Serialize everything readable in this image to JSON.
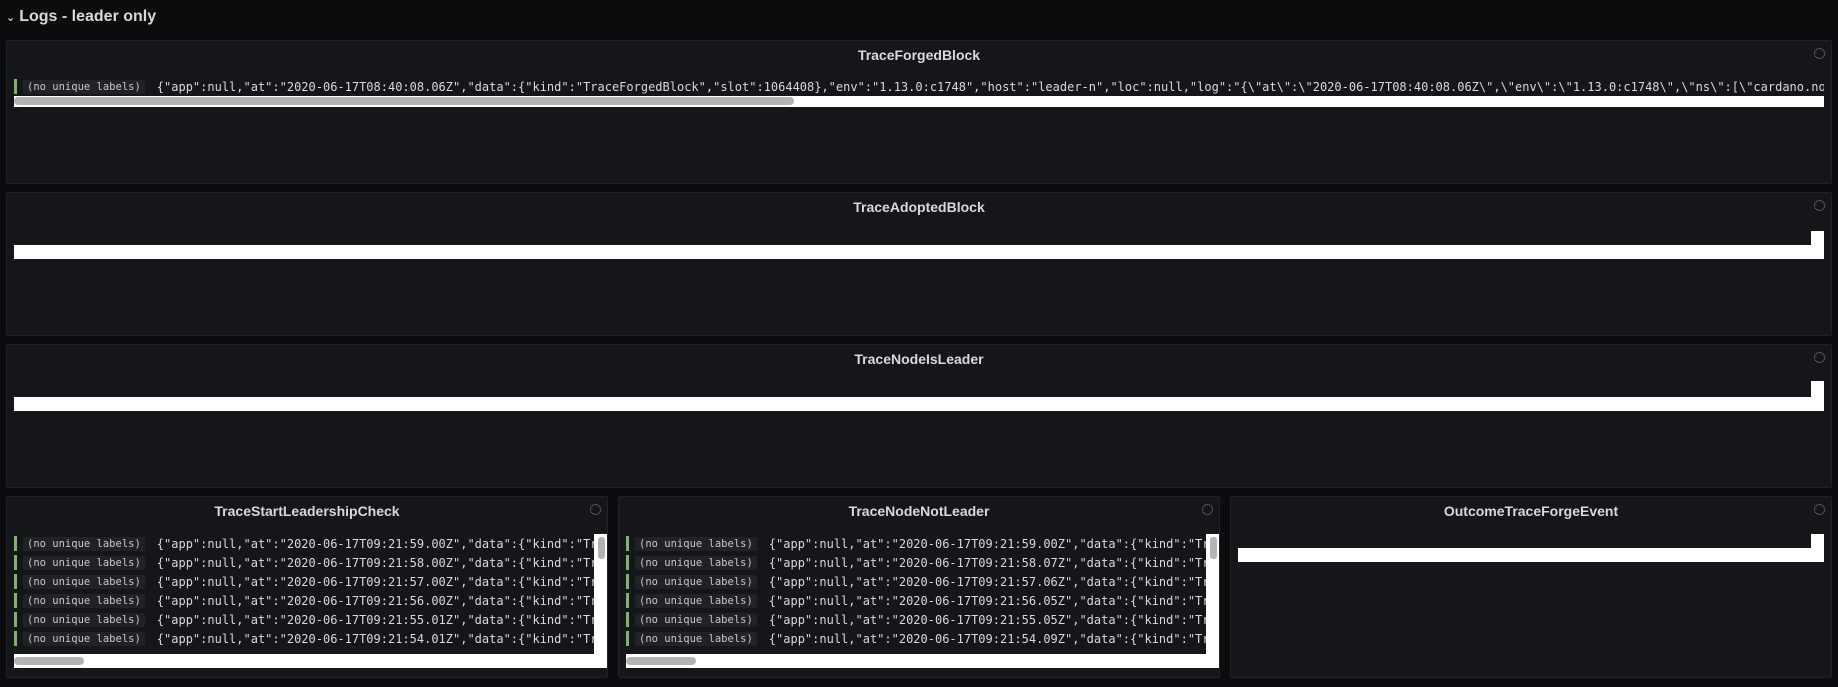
{
  "row": {
    "title": "Logs - leader only"
  },
  "label": "(no unique labels)",
  "panels": {
    "forged": {
      "title": "TraceForgedBlock",
      "line": "{\"app\":null,\"at\":\"2020-06-17T08:40:08.06Z\",\"data\":{\"kind\":\"TraceForgedBlock\",\"slot\":1064408},\"env\":\"1.13.0:c1748\",\"host\":\"leader-n\",\"loc\":null,\"log\":\"{\\\"at\\\":\\\"2020-06-17T08:40:08.06Z\\\",\\\"env\\\":\\\"1.13.0:c1748\\\",\\\"ns\\\":[\\\"cardano.no"
    },
    "adopted": {
      "title": "TraceAdoptedBlock"
    },
    "isLeader": {
      "title": "TraceNodeIsLeader"
    },
    "startCheck": {
      "title": "TraceStartLeadershipCheck",
      "lines": [
        "{\"app\":null,\"at\":\"2020-06-17T09:21:59.00Z\",\"data\":{\"kind\":\"Tr",
        "{\"app\":null,\"at\":\"2020-06-17T09:21:58.00Z\",\"data\":{\"kind\":\"Tr",
        "{\"app\":null,\"at\":\"2020-06-17T09:21:57.00Z\",\"data\":{\"kind\":\"Tr",
        "{\"app\":null,\"at\":\"2020-06-17T09:21:56.00Z\",\"data\":{\"kind\":\"Tr",
        "{\"app\":null,\"at\":\"2020-06-17T09:21:55.01Z\",\"data\":{\"kind\":\"Tr",
        "{\"app\":null,\"at\":\"2020-06-17T09:21:54.01Z\",\"data\":{\"kind\":\"Tr"
      ]
    },
    "notLeader": {
      "title": "TraceNodeNotLeader",
      "lines": [
        "{\"app\":null,\"at\":\"2020-06-17T09:21:59.00Z\",\"data\":{\"kind\":\"Tr",
        "{\"app\":null,\"at\":\"2020-06-17T09:21:58.07Z\",\"data\":{\"kind\":\"Tr",
        "{\"app\":null,\"at\":\"2020-06-17T09:21:57.06Z\",\"data\":{\"kind\":\"Tr",
        "{\"app\":null,\"at\":\"2020-06-17T09:21:56.05Z\",\"data\":{\"kind\":\"Tr",
        "{\"app\":null,\"at\":\"2020-06-17T09:21:55.05Z\",\"data\":{\"kind\":\"Tr",
        "{\"app\":null,\"at\":\"2020-06-17T09:21:54.09Z\",\"data\":{\"kind\":\"Tr"
      ]
    },
    "outcome": {
      "title": "OutcomeTraceForgeEvent"
    }
  }
}
